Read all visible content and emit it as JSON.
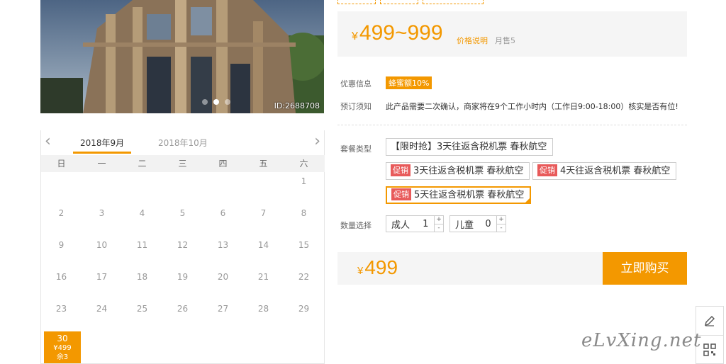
{
  "photo": {
    "id_label": "ID:2688708"
  },
  "calendar": {
    "prev_icon": "chevron-left-icon",
    "next_icon": "chevron-right-icon",
    "tabs": [
      "2018年9月",
      "2018年10月"
    ],
    "weekdays": [
      "日",
      "一",
      "二",
      "三",
      "四",
      "五",
      "六"
    ],
    "rows": [
      [
        "",
        "",
        "",
        "",
        "",
        "",
        "1"
      ],
      [
        "2",
        "3",
        "4",
        "5",
        "6",
        "7",
        "8"
      ],
      [
        "9",
        "10",
        "11",
        "12",
        "13",
        "14",
        "15"
      ],
      [
        "16",
        "17",
        "18",
        "19",
        "20",
        "21",
        "22"
      ],
      [
        "23",
        "24",
        "25",
        "26",
        "27",
        "28",
        "29"
      ]
    ],
    "selected_day": {
      "day": "30",
      "price": "¥499",
      "remaining": "余3"
    }
  },
  "price": {
    "currency": "¥",
    "range": "499~999",
    "explain_link": "价格说明",
    "monthly_sales": "月售5"
  },
  "info": {
    "discount_label": "优惠信息",
    "discount_badge": "蜂蜜额10%",
    "notice_label": "预订须知",
    "notice_text": "此产品需要二次确认，商家将在9个工作小时内（工作日9:00-18:00）核实是否有位!"
  },
  "packages": {
    "label": "套餐类型",
    "promo_tag": "促销",
    "items": [
      "【限时抢】3天往返含税机票 春秋航空",
      "3天往返含税机票 春秋航空",
      "4天往返含税机票 春秋航空",
      "5天往返含税机票 春秋航空"
    ]
  },
  "quantity": {
    "label": "数量选择",
    "adult_label": "成人",
    "adult_value": "1",
    "child_label": "儿童",
    "child_value": "0",
    "plus": "+",
    "minus": "-"
  },
  "buy": {
    "currency": "¥",
    "total": "499",
    "button_label": "立即购买"
  },
  "side_tools": {
    "edit_icon": "pencil-icon",
    "qr_icon": "qr-code-icon"
  },
  "watermark": "eLvXing.net",
  "colors": {
    "accent": "#f39800",
    "promo": "#e85a5a",
    "panel": "#f5f5f5"
  }
}
